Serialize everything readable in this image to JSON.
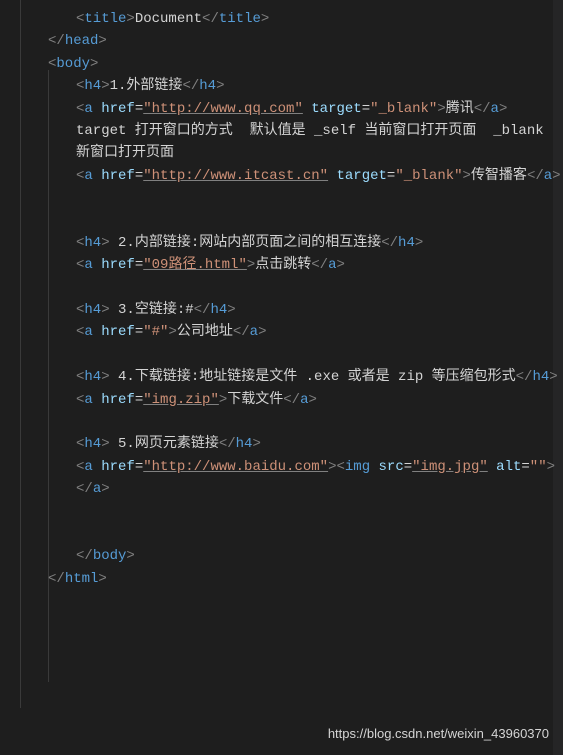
{
  "code": {
    "l1": {
      "tag_open": "<",
      "tag": "title",
      "tag_close": ">",
      "text": "Document",
      "end_open": "</",
      "end_close": ">"
    },
    "l2": {
      "end_open": "</",
      "tag": "head",
      "end_close": ">"
    },
    "l3": {
      "tag_open": "<",
      "tag": "body",
      "tag_close": ">"
    },
    "l4": {
      "tag_open": "<",
      "tag": "h4",
      "tag_close": ">",
      "text": "1.外部链接",
      "end_open": "</",
      "end_close": ">"
    },
    "l5": {
      "tag_open": "<",
      "tag": "a",
      "sp": " ",
      "attr1": "href",
      "eq": "=",
      "val1": "\"http://www.qq.com\"",
      "sp2": " ",
      "attr2": "target",
      "val2": "\"_blank\"",
      "tag_close": ">",
      "text": "腾讯",
      "end_open": "</",
      "end_close": ">"
    },
    "l6": {
      "text": "target 打开窗口的方式  默认值是 _self 当前窗口打开页面  _blank 新窗口打开页面"
    },
    "l7": {
      "tag_open": "<",
      "tag": "a",
      "sp": " ",
      "attr1": "href",
      "eq": "=",
      "val1": "\"http://www.itcast.cn\"",
      "sp2": " ",
      "attr2": "target",
      "val2": "\"_blank\"",
      "tag_close": ">",
      "text": "传智播客",
      "end_open": "</",
      "end_close": ">"
    },
    "l8": {
      "tag_open": "<",
      "tag": "h4",
      "tag_close": "> ",
      "text": "2.内部链接:网站内部页面之间的相互连接",
      "end_open": "</",
      "end_close": ">"
    },
    "l9": {
      "tag_open": "<",
      "tag": "a",
      "sp": " ",
      "attr1": "href",
      "eq": "=",
      "val1": "\"09路径.html\"",
      "tag_close": ">",
      "text": "点击跳转",
      "end_open": "</",
      "end_close": ">"
    },
    "l10": {
      "tag_open": "<",
      "tag": "h4",
      "tag_close": "> ",
      "text": "3.空链接:#",
      "end_open": "</",
      "end_close": ">"
    },
    "l11": {
      "tag_open": "<",
      "tag": "a",
      "sp": " ",
      "attr1": "href",
      "eq": "=",
      "val1": "\"#\"",
      "tag_close": ">",
      "text": "公司地址",
      "end_open": "</",
      "end_close": ">"
    },
    "l12": {
      "tag_open": "<",
      "tag": "h4",
      "tag_close": "> ",
      "text": "4.下载链接:地址链接是文件 .exe 或者是 zip 等压缩包形式",
      "end_open": "</",
      "end_close": ">"
    },
    "l13": {
      "tag_open": "<",
      "tag": "a",
      "sp": " ",
      "attr1": "href",
      "eq": "=",
      "val1": "\"img.zip\"",
      "tag_close": ">",
      "text": "下载文件",
      "end_open": "</",
      "end_close": ">"
    },
    "l14": {
      "tag_open": "<",
      "tag": "h4",
      "tag_close": "> ",
      "text": "5.网页元素链接",
      "end_open": "</",
      "end_close": ">"
    },
    "l15": {
      "tag_open": "<",
      "tag": "a",
      "sp": " ",
      "attr1": "href",
      "eq": "=",
      "val1": "\"http://www.baidu.com\"",
      "tag_close": ">",
      "itag_open": "<",
      "itag": "img",
      "isp": " ",
      "iattr1": "src",
      "ival1": "\"img.jpg\"",
      "isp2": " ",
      "iattr2": "alt",
      "ival2": "\"\"",
      "itag_close": ">",
      "end_open": "</",
      "end_close": ">"
    },
    "l16": {
      "end_open": "</",
      "tag": "body",
      "end_close": ">"
    },
    "l17": {
      "end_open": "</",
      "tag": "html",
      "end_close": ">"
    }
  },
  "watermark": "https://blog.csdn.net/weixin_43960370"
}
